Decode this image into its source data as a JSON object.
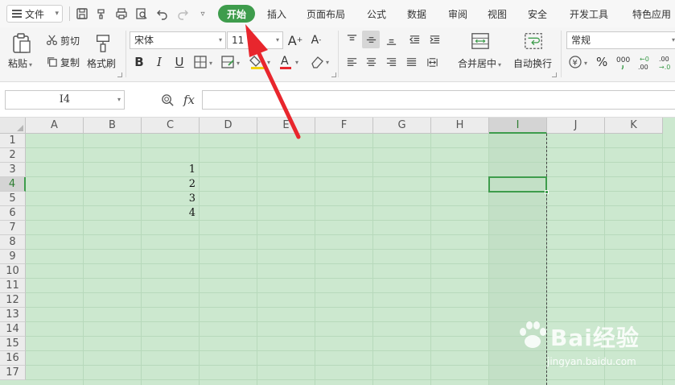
{
  "app": {
    "file_menu_label": "文件"
  },
  "tabs": [
    {
      "label": "开始",
      "active": true
    },
    {
      "label": "插入"
    },
    {
      "label": "页面布局"
    },
    {
      "label": "公式"
    },
    {
      "label": "数据"
    },
    {
      "label": "审阅"
    },
    {
      "label": "视图"
    },
    {
      "label": "安全"
    },
    {
      "label": "开发工具"
    },
    {
      "label": "特色应用"
    }
  ],
  "ribbon": {
    "paste": "粘贴",
    "cut": "剪切",
    "copy": "复制",
    "format_painter": "格式刷",
    "font_name": "宋体",
    "font_size": "11",
    "bold": "B",
    "italic": "I",
    "underline": "U",
    "merge_center": "合并居中",
    "wrap_text": "自动换行",
    "number_format": "常规",
    "currency": "¥",
    "percent": "%",
    "thousands": "000",
    "inc_decimal": "+0 .00",
    "dec_decimal": ".00 +.0"
  },
  "formula_bar": {
    "name_box": "I4",
    "fx": "fx",
    "formula": ""
  },
  "grid": {
    "columns": [
      "A",
      "B",
      "C",
      "D",
      "E",
      "F",
      "G",
      "H",
      "I",
      "J",
      "K"
    ],
    "selected_column": "I",
    "rows": [
      "1",
      "2",
      "3",
      "4",
      "5",
      "6",
      "7",
      "8",
      "9",
      "10",
      "11",
      "12",
      "13",
      "14",
      "15",
      "16",
      "17"
    ],
    "selected_row": "4",
    "cell_values": [
      {
        "ref": "C3",
        "value": "1"
      },
      {
        "ref": "C4",
        "value": "2"
      },
      {
        "ref": "C5",
        "value": "3"
      },
      {
        "ref": "C6",
        "value": "4"
      }
    ]
  },
  "watermark": {
    "brand": "Bai经验",
    "url": "jingyan.baidu.com"
  },
  "colors": {
    "accent": "#3e9c4c",
    "sheet_bg": "#cce8cf",
    "annotation": "#e8262d"
  }
}
